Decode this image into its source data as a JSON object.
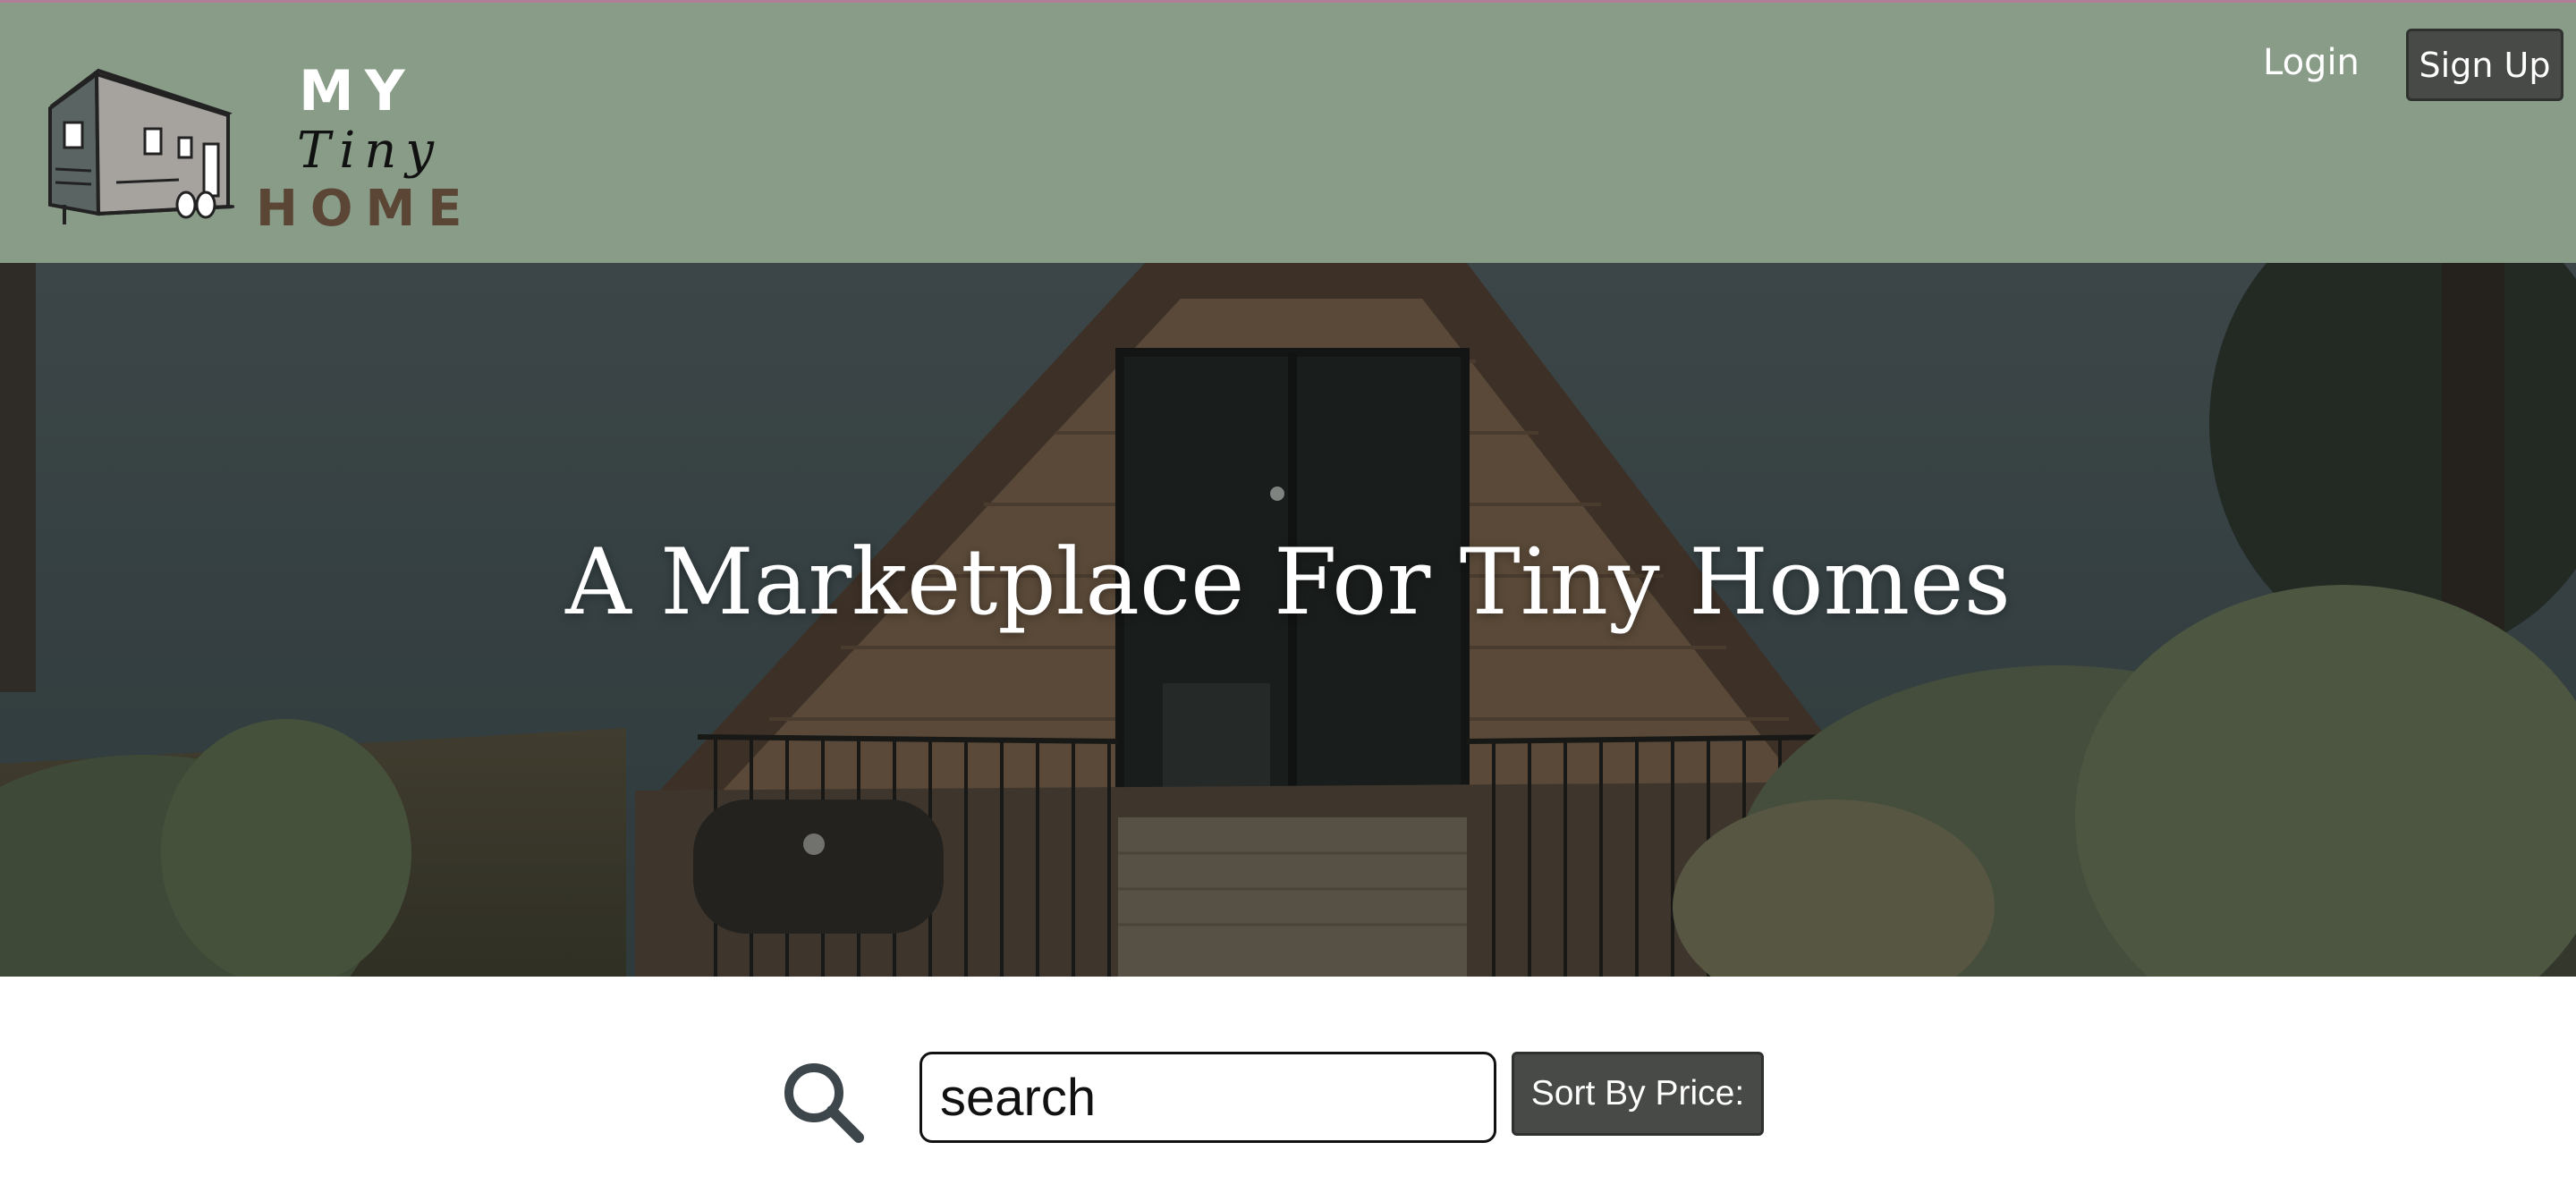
{
  "header": {
    "background_color": "#889c88",
    "logo": {
      "line1": "MY",
      "line2": "Tiny",
      "line3": "HOME",
      "icon": "tiny-house-logo-icon"
    },
    "nav": {
      "login_label": "Login",
      "signup_label": "Sign Up"
    }
  },
  "hero": {
    "title": "A Marketplace For Tiny Homes",
    "image": "a-frame-cabin-by-lake-photo"
  },
  "search": {
    "icon": "search-icon",
    "placeholder": "search",
    "value": "",
    "sort_label": "Sort By Price:"
  },
  "colors": {
    "header_bg": "#889c88",
    "button_bg": "#474a46",
    "logo_brown": "#5b4636"
  }
}
